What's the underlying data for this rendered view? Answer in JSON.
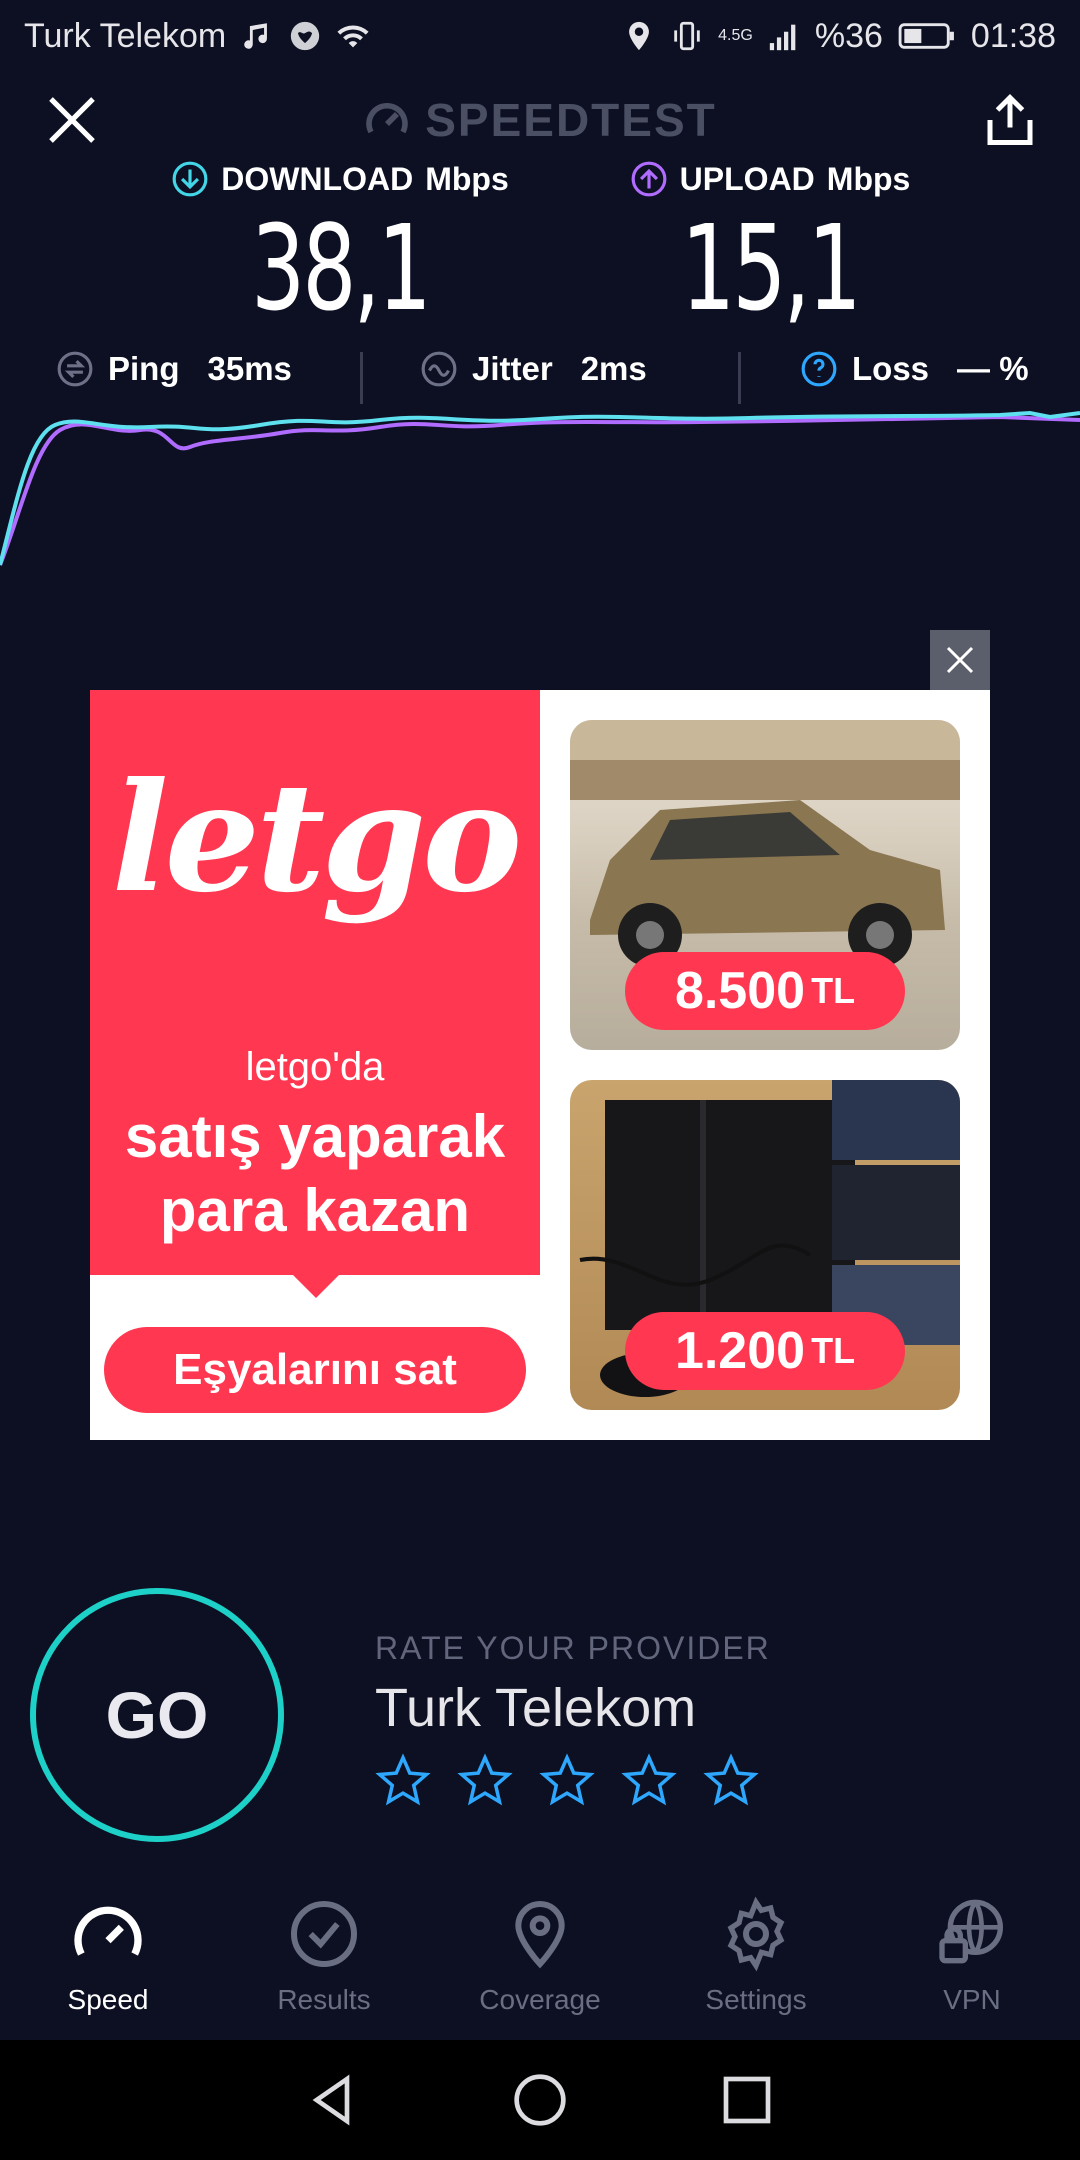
{
  "statusbar": {
    "carrier": "Turk Telekom",
    "network": "4.5G",
    "battery": "%36",
    "time": "01:38"
  },
  "header": {
    "title": "SPEEDTEST"
  },
  "metrics": {
    "download": {
      "label": "DOWNLOAD",
      "unit": "Mbps",
      "value": "38,1",
      "color": "#42d6e6"
    },
    "upload": {
      "label": "UPLOAD",
      "unit": "Mbps",
      "value": "15,1",
      "color": "#b06bff"
    }
  },
  "stats": {
    "ping": {
      "label": "Ping",
      "value": "35ms"
    },
    "jitter": {
      "label": "Jitter",
      "value": "2ms"
    },
    "loss": {
      "label": "Loss",
      "value": "— %"
    }
  },
  "ad": {
    "brand": "letgo",
    "subtitle": "letgo'da",
    "headline_1": "satış yaparak",
    "headline_2": "para kazan",
    "cta": "Eşyalarını sat",
    "card1_price": "8.500",
    "card2_price": "1.200",
    "currency": "TL",
    "accent": "#ff3750"
  },
  "go_button": "GO",
  "rating": {
    "label": "RATE YOUR PROVIDER",
    "provider": "Turk Telekom",
    "stars": 5
  },
  "tabs": [
    {
      "label": "Speed",
      "icon": "speedometer-icon"
    },
    {
      "label": "Results",
      "icon": "check-circle-icon"
    },
    {
      "label": "Coverage",
      "icon": "location-pin-icon"
    },
    {
      "label": "Settings",
      "icon": "gear-icon"
    },
    {
      "label": "VPN",
      "icon": "globe-lock-icon"
    }
  ],
  "colors": {
    "background": "#0d1022",
    "accent_teal": "#1dd1c8",
    "star_blue": "#2ea8ff"
  }
}
